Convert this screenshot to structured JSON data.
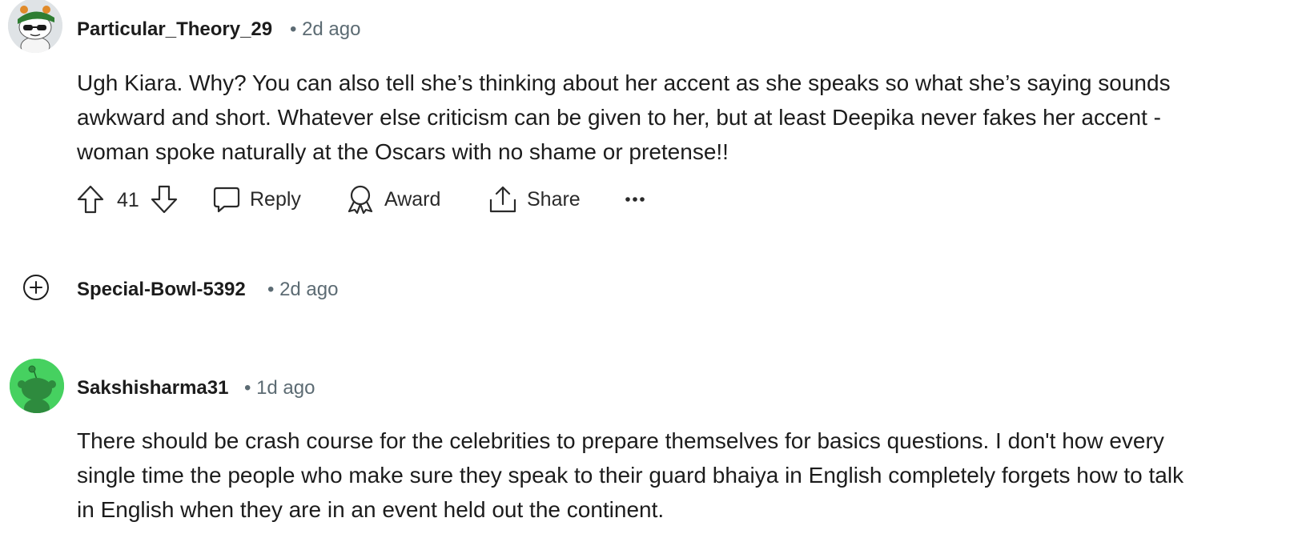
{
  "comments": [
    {
      "username": "Particular_Theory_29",
      "time": "• 2d ago",
      "lines": [
        "Ugh Kiara. Why? You can also tell she’s thinking about her accent as she speaks so what she’s saying sounds",
        "awkward and short. Whatever else criticism can be given to her, but at least Deepika never fakes her accent -",
        "woman spoke naturally at the Oscars with no shame or pretense!!"
      ],
      "score": "41",
      "reply_label": "Reply",
      "award_label": "Award",
      "share_label": "Share"
    },
    {
      "username": "Special-Bowl-5392",
      "time": "• 2d ago",
      "collapsed": true
    },
    {
      "username": "Sakshisharma31",
      "time": "• 1d ago",
      "lines": [
        "There should be crash course for the celebrities to prepare themselves for basics questions. I don't how every",
        "single time the people who make sure they speak to their guard bhaiya in English completely forgets how to talk",
        "in English when they are in an event held out the continent."
      ]
    }
  ],
  "icons": {
    "upvote": "arrow-up-icon",
    "downvote": "arrow-down-icon",
    "reply": "speech-bubble-icon",
    "award": "award-ribbon-icon",
    "share": "share-upload-icon",
    "more": "ellipsis-icon",
    "expand": "plus-circle-icon"
  },
  "colors": {
    "meta_gray": "#5c6b73",
    "avatar_green": "#46d160"
  }
}
